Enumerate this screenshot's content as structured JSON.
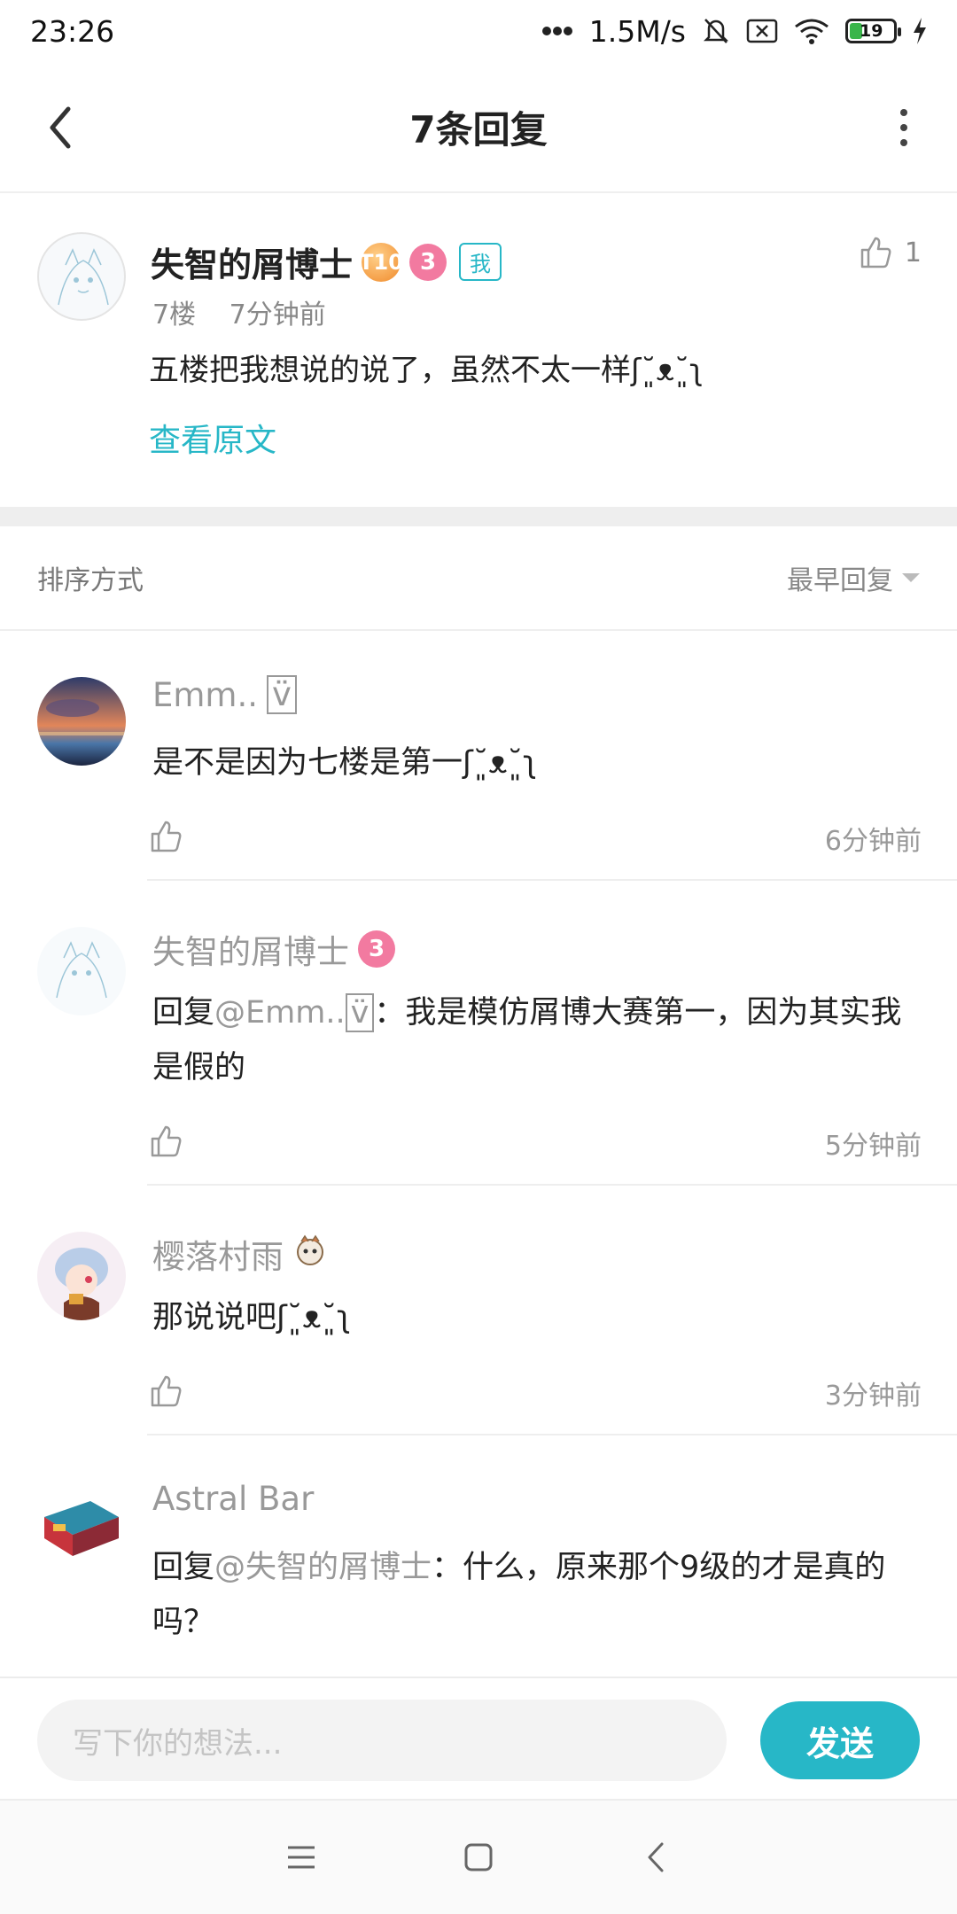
{
  "status_bar": {
    "time": "23:26",
    "network_speed": "1.5M/s",
    "battery": "19",
    "icons": [
      "signal-dots-icon",
      "mute-bell-icon",
      "no-sim-icon",
      "wifi-icon",
      "battery-icon",
      "charging-icon"
    ]
  },
  "header": {
    "title": "7条回复",
    "back_icon": "chevron-left-icon",
    "more_icon": "more-vertical-icon"
  },
  "top_comment": {
    "username": "失智的屑博士",
    "level_badge": "T10",
    "pink_badge": "3",
    "me_badge": "我",
    "floor": "7楼",
    "time": "7分钟前",
    "text": "五楼把我想说的说了，虽然不太一样ʃ˘͈ᴥ˘͈ʅ",
    "view_original": "查看原文",
    "like_count": "1"
  },
  "sort": {
    "label": "排序方式",
    "value": "最早回复"
  },
  "replies": [
    {
      "username": "Emm..",
      "username_box": "v̈",
      "text": "是不是因为七楼是第一ʃ˘͈ᴥ˘͈ʅ",
      "time": "6分钟前"
    },
    {
      "username": "失智的屑博士",
      "pink_badge": "3",
      "reply_prefix": "回复",
      "reply_at": "@Emm..",
      "reply_at_box": "v̈",
      "reply_colon": "：",
      "text": "我是模仿屑博大赛第一，因为其实我是假的",
      "time": "5分钟前"
    },
    {
      "username": "樱落村雨",
      "text": "那说说吧ʃ˘͈ᴥ˘͈ʅ",
      "time": "3分钟前"
    },
    {
      "username": "Astral Bar",
      "reply_prefix": "回复",
      "reply_at": "@失智的屑博士",
      "reply_colon": "：",
      "text": "什么，原来那个9级的才是真的吗？"
    }
  ],
  "input": {
    "placeholder": "写下你的想法...",
    "send_label": "发送"
  },
  "colors": {
    "accent": "#27b7c7",
    "pink_badge": "#f27aa0",
    "level_badge": "#f08a2b"
  }
}
